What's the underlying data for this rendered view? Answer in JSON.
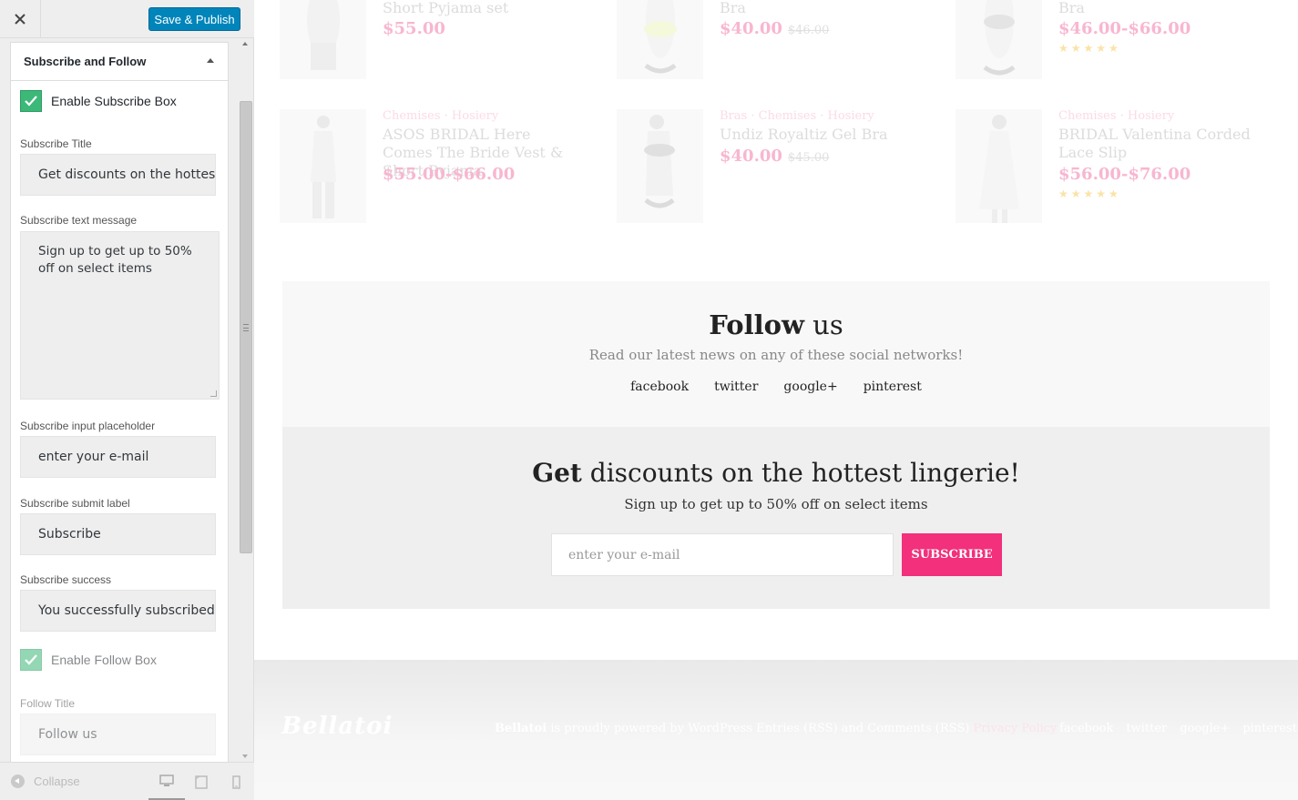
{
  "header": {
    "close_icon": "close-icon",
    "save_label": "Save & Publish"
  },
  "section": {
    "title": "Subscribe and Follow",
    "enable_subscribe_label": "Enable Subscribe Box",
    "subscribe_title_label": "Subscribe Title",
    "subscribe_title_value": "Get discounts on the hottest",
    "subscribe_text_label": "Subscribe text message",
    "subscribe_text_value": "Sign up to get up to 50% off on select items",
    "subscribe_placeholder_label": "Subscribe input placeholder",
    "subscribe_placeholder_value": "enter your e-mail",
    "subscribe_submit_label": "Subscribe submit label",
    "subscribe_submit_value": "Subscribe",
    "subscribe_success_label": "Subscribe success",
    "subscribe_success_value": "You successfully subscribed",
    "enable_follow_label": "Enable Follow Box",
    "follow_title_label": "Follow Title",
    "follow_title_value": "Follow us"
  },
  "footer_controls": {
    "collapse_label": "Collapse",
    "devices": [
      "desktop-icon",
      "tablet-icon",
      "mobile-icon"
    ]
  },
  "products_top": [
    {
      "name": "Short Pyjama set",
      "price": "$55.00"
    },
    {
      "name": "Bra",
      "price": "$40.00",
      "old_price": "$46.00"
    },
    {
      "name": "Bra",
      "price": "$46.00-$66.00",
      "stars": "★★★★★"
    }
  ],
  "products": [
    {
      "cats": "Chemises · Hosiery",
      "name": "ASOS BRIDAL Here Comes The Bride Vest & Short Pyjama",
      "price": "$55.00-$66.00"
    },
    {
      "cats": "Bras · Chemises · Hosiery",
      "name": "Undiz Royaltiz Gel Bra",
      "price": "$40.00",
      "old_price": "$45.00"
    },
    {
      "cats": "Chemises · Hosiery",
      "name": "BRIDAL Valentina Corded Lace Slip",
      "price": "$56.00-$76.00",
      "stars": "★★★★★"
    }
  ],
  "follow": {
    "title_bold": "Follow",
    "title_rest": " us",
    "text": "Read our latest news on any of these social networks!",
    "links": [
      "facebook",
      "twitter",
      "google+",
      "pinterest"
    ]
  },
  "subscribe": {
    "title_bold": "Get",
    "title_rest": " discounts on the hottest lingerie!",
    "text": "Sign up to get up to 50% off on select items",
    "placeholder": "enter your e-mail",
    "button": "SUBSCRIBE"
  },
  "site_footer": {
    "logo": "Bellatoi",
    "brand": "Bellatoi",
    "credit": " is proudly powered by WordPress Entries (RSS) and Comments (RSS) ",
    "privacy": "Privacy Policy",
    "links": [
      "facebook",
      "twitter",
      "google+",
      "pinterest"
    ]
  },
  "colors": {
    "accent": "#f2307c",
    "primary_button": "#0085ba",
    "checkbox": "#3cb878"
  }
}
